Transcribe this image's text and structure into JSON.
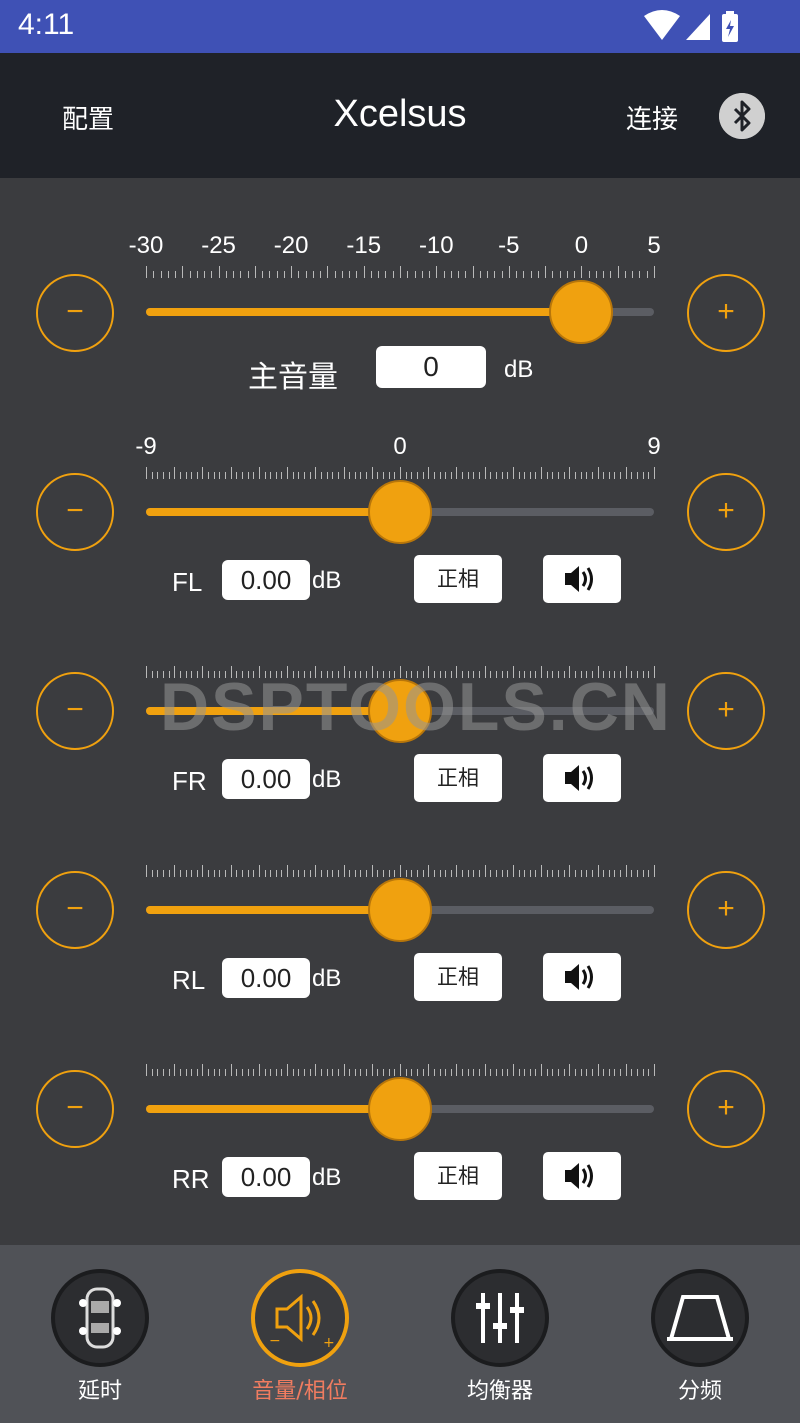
{
  "status_bar": {
    "time": "4:11"
  },
  "app_bar": {
    "config_label": "配置",
    "title": "Xcelsus",
    "connect_label": "连接"
  },
  "master": {
    "scale_labels": [
      "-30",
      "-25",
      "-20",
      "-15",
      "-10",
      "-5",
      "0",
      "5"
    ],
    "label": "主音量",
    "value": "0",
    "unit": "dB",
    "slider_value": 0,
    "range": [
      -30,
      5
    ],
    "minus_label": "−",
    "plus_label": "+"
  },
  "channel_scale_labels": [
    "-9",
    "0",
    "9"
  ],
  "channels": [
    {
      "name": "FL",
      "value": "0.00",
      "unit": "dB",
      "phase_label": "正相",
      "slider_value": 0,
      "range": [
        -9,
        9
      ]
    },
    {
      "name": "FR",
      "value": "0.00",
      "unit": "dB",
      "phase_label": "正相",
      "slider_value": 0,
      "range": [
        -9,
        9
      ]
    },
    {
      "name": "RL",
      "value": "0.00",
      "unit": "dB",
      "phase_label": "正相",
      "slider_value": 0,
      "range": [
        -9,
        9
      ]
    },
    {
      "name": "RR",
      "value": "0.00",
      "unit": "dB",
      "phase_label": "正相",
      "slider_value": 0,
      "range": [
        -9,
        9
      ]
    }
  ],
  "buttons": {
    "minus": "−",
    "plus": "+"
  },
  "watermark": "DSPTOOLS.CN",
  "bottom_nav": [
    {
      "label": "延时",
      "icon": "car-speakers-icon",
      "active": false
    },
    {
      "label": "音量/相位",
      "icon": "volume-phase-icon",
      "active": true
    },
    {
      "label": "均衡器",
      "icon": "equalizer-sliders-icon",
      "active": false
    },
    {
      "label": "分频",
      "icon": "crossover-icon",
      "active": false
    }
  ],
  "colors": {
    "accent": "#f0a10f",
    "status_bar": "#3f51b5",
    "app_bar": "#1f2228",
    "background": "#3b3c3f",
    "nav_active_text": "#f07c60"
  }
}
